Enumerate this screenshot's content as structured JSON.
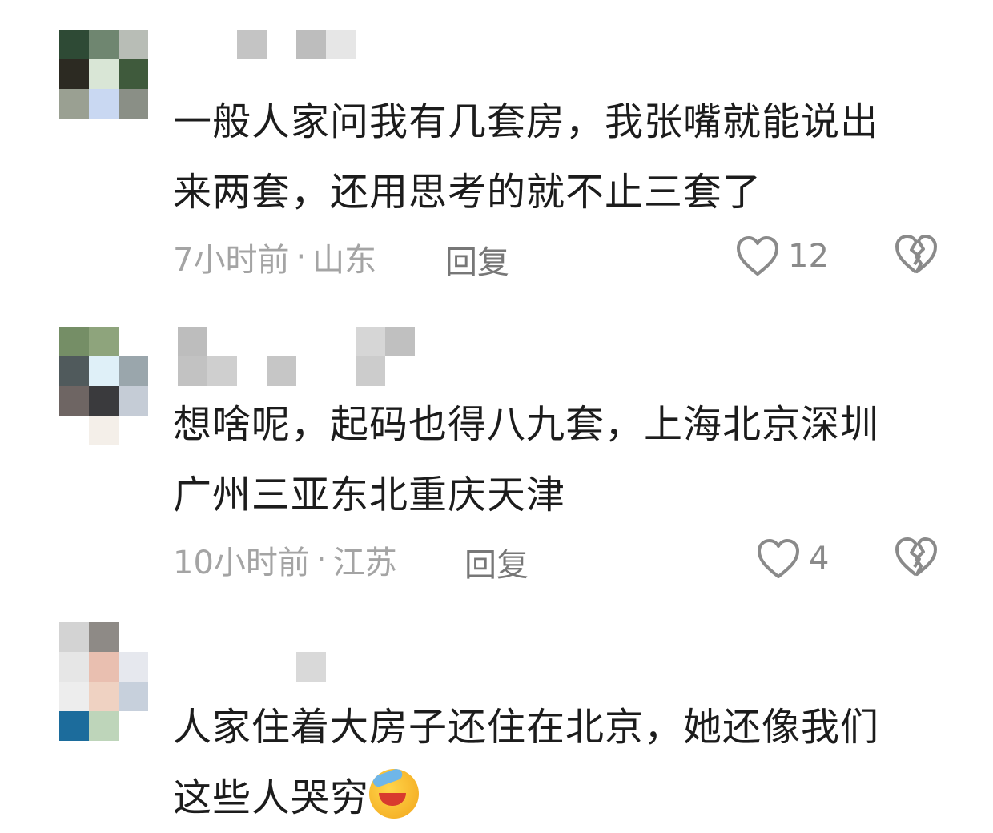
{
  "comments": [
    {
      "text_line1": "一般人家问我有几套房，我张嘴就能说出",
      "text_line2": "来两套，还用思考的就不止三套了",
      "time": "7小时前",
      "dot": "·",
      "location": "山东",
      "reply_label": "回复",
      "like_count": "12"
    },
    {
      "text_line1": "想啥呢，起码也得八九套，上海北京深圳",
      "text_line2": "广州三亚东北重庆天津",
      "time": "10小时前",
      "dot": "·",
      "location": "江苏",
      "reply_label": "回复",
      "like_count": "4"
    },
    {
      "text_line1": "人家住着大房子还住在北京，她还像我们",
      "text_line2": "这些人哭穷",
      "emoji": "face-with-hand-over-eyes-crying"
    }
  ],
  "icons": {
    "like": "heart-outline-icon",
    "dislike": "broken-heart-icon"
  },
  "colors": {
    "text": "#1c1c1c",
    "meta": "#a4a4a4",
    "icon": "#8a8a8a"
  }
}
